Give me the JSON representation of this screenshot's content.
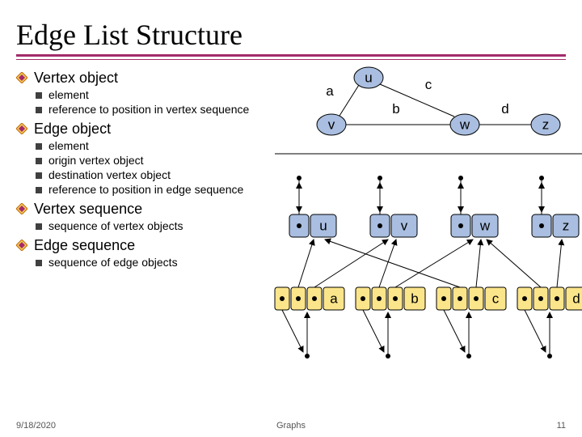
{
  "title": "Edge List Structure",
  "bullets": {
    "l1": [
      {
        "label": "Vertex object",
        "children": [
          "element",
          "reference to position in vertex sequence"
        ]
      },
      {
        "label": "Edge object",
        "children": [
          "element",
          "origin vertex object",
          "destination vertex object",
          "reference to position in edge sequence"
        ]
      },
      {
        "label": "Vertex sequence",
        "children": [
          "sequence of vertex objects"
        ]
      },
      {
        "label": "Edge sequence",
        "children": [
          "sequence of edge objects"
        ]
      }
    ]
  },
  "graph": {
    "vertices": [
      "u",
      "v",
      "w",
      "z"
    ],
    "edges": [
      "a",
      "b",
      "c",
      "d"
    ],
    "edge_endpoints": {
      "a": [
        "u",
        "v"
      ],
      "b": [
        "v",
        "w"
      ],
      "c": [
        "u",
        "w"
      ],
      "d": [
        "w",
        "z"
      ]
    },
    "vertex_sequence": [
      "u",
      "v",
      "w",
      "z"
    ],
    "edge_sequence": [
      "a",
      "b",
      "c",
      "d"
    ]
  },
  "footer": {
    "date": "9/18/2020",
    "center": "Graphs",
    "page": "11"
  }
}
